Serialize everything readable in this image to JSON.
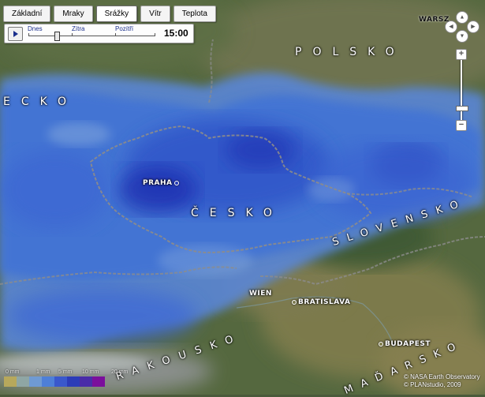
{
  "tabs": [
    {
      "label": "Základní",
      "active": false
    },
    {
      "label": "Mraky",
      "active": false
    },
    {
      "label": "Srážky",
      "active": true
    },
    {
      "label": "Vítr",
      "active": false
    },
    {
      "label": "Teplota",
      "active": false
    }
  ],
  "time": {
    "labels": [
      "Dnes",
      "Zítra",
      "Pozítří"
    ],
    "value": "15:00"
  },
  "map_labels": {
    "countries": [
      "POLSKO",
      "ČESKO",
      "SLOVENSKO",
      "RAKOUSKO",
      "ECKO",
      "MAĎARSKO"
    ],
    "cities": [
      "WARSZ",
      "PRAHA",
      "WIEN",
      "BRATISLAVA",
      "BUDAPEST"
    ]
  },
  "legend": {
    "labels": [
      "0 mm",
      "1 mm",
      "5 mm",
      "10 mm",
      "20 mm"
    ],
    "colors": [
      "#b7a85c",
      "#8fa6a4",
      "#6f9ad3",
      "#4e7fd8",
      "#3a58cc",
      "#2c3cb8",
      "#4a2ca8",
      "#7b0f9c"
    ]
  },
  "credits": [
    "© NASA Earth Observatory",
    "© PLANstudio, 2009"
  ],
  "icons": {
    "nav": [
      "arrow-up-icon",
      "arrow-left-icon",
      "arrow-right-icon",
      "arrow-down-icon"
    ],
    "zoom": [
      "zoom-in-icon",
      "zoom-out-icon"
    ],
    "play": "play-icon"
  }
}
